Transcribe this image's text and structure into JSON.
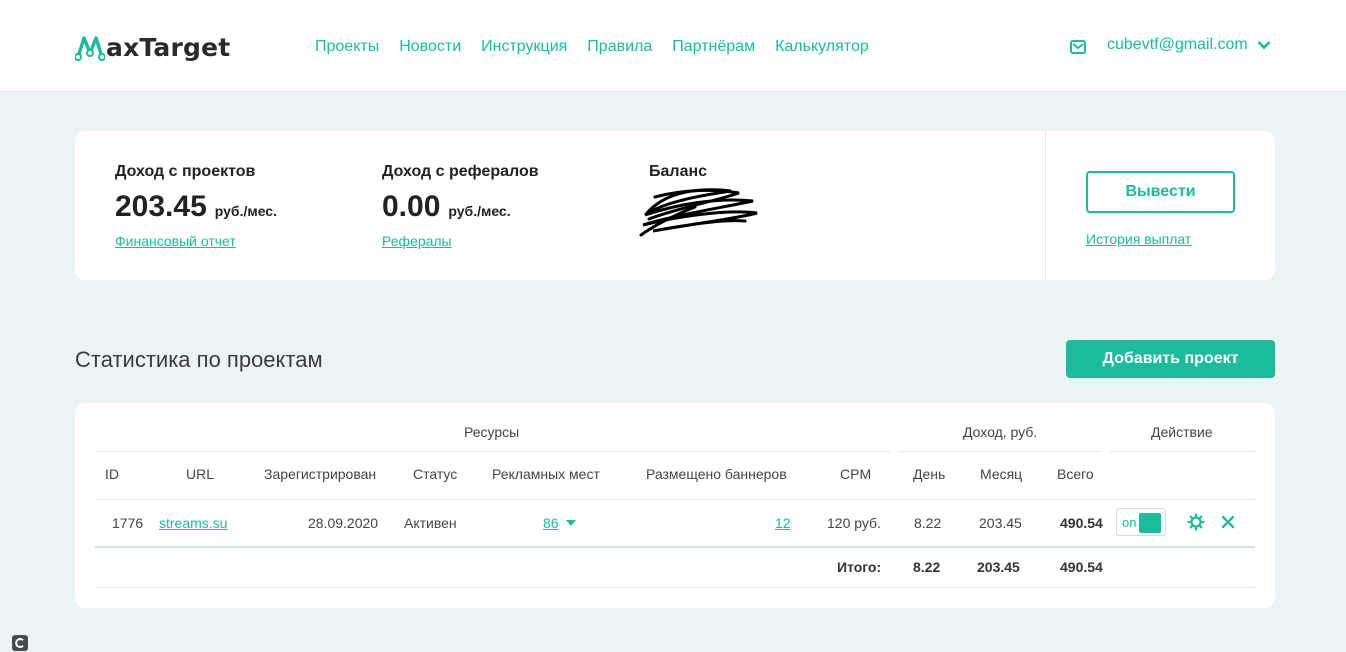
{
  "header": {
    "logo_text": "axTarget",
    "nav": [
      "Проекты",
      "Новости",
      "Инструкция",
      "Правила",
      "Партнёрам",
      "Калькулятор"
    ],
    "user_email": "cubevtf@gmail.com"
  },
  "income": {
    "projects": {
      "label": "Доход с проектов",
      "value": "203.45",
      "unit": "руб./мес.",
      "link": "Финансовый отчет"
    },
    "referrals": {
      "label": "Доход с рефералов",
      "value": "0.00",
      "unit": "руб./мес.",
      "link": "Рефералы"
    },
    "balance": {
      "label": "Баланс"
    },
    "withdraw_button": "Вывести",
    "history_link": "История выплат"
  },
  "stats": {
    "title": "Статистика по проектам",
    "add_button": "Добавить проект",
    "group_headers": {
      "resources": "Ресурсы",
      "income": "Доход, руб.",
      "action": "Действие"
    },
    "columns": {
      "id": "ID",
      "url": "URL",
      "registered": "Зарегистрирован",
      "status": "Статус",
      "ad_places": "Рекламных мест",
      "banners": "Размещено баннеров",
      "cpm": "CPM",
      "day": "День",
      "month": "Месяц",
      "total": "Всего"
    },
    "row": {
      "id": "1776",
      "url": "streams.su",
      "registered": "28.09.2020",
      "status": "Активен",
      "ad_places": "86",
      "banners": "12",
      "cpm": "120 руб.",
      "day": "8.22",
      "month": "203.45",
      "total": "490.54",
      "toggle": "on"
    },
    "totals": {
      "label": "Итого:",
      "day": "8.22",
      "month": "203.45",
      "total": "490.54"
    }
  },
  "colors": {
    "accent": "#1bbc9b",
    "background": "#ecf5f5"
  },
  "icons": [
    "logo-icon",
    "mail-icon",
    "chevron-down-icon",
    "caret-down-icon",
    "gear-icon",
    "close-icon",
    "c-badge-icon"
  ]
}
